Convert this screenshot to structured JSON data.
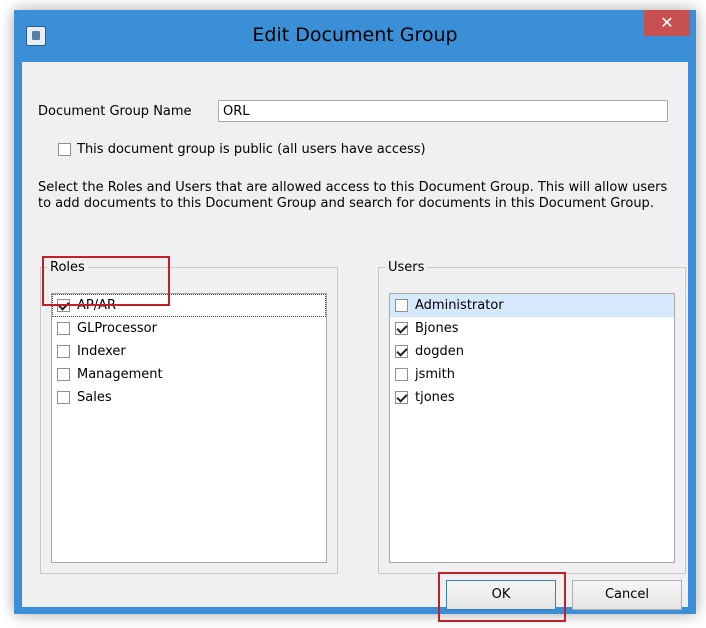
{
  "window": {
    "title": "Edit Document Group",
    "close_glyph": "✕"
  },
  "form": {
    "name_label": "Document Group Name",
    "name_value": "ORL",
    "public_label": "This document group is public (all users have access)",
    "public_checked": false,
    "instructions": "Select the Roles and Users that are allowed access to this Document Group.  This will allow users to add documents to this Document Group and search for documents in this Document Group."
  },
  "roles": {
    "legend": "Roles",
    "items": [
      {
        "label": "AP/AR",
        "checked": true
      },
      {
        "label": "GLProcessor",
        "checked": false
      },
      {
        "label": "Indexer",
        "checked": false
      },
      {
        "label": "Management",
        "checked": false
      },
      {
        "label": "Sales",
        "checked": false
      }
    ]
  },
  "users": {
    "legend": "Users",
    "items": [
      {
        "label": "Administrator",
        "checked": false
      },
      {
        "label": "Bjones",
        "checked": true
      },
      {
        "label": "dogden",
        "checked": true
      },
      {
        "label": "jsmith",
        "checked": false
      },
      {
        "label": "tjones",
        "checked": true
      }
    ]
  },
  "buttons": {
    "ok": "OK",
    "cancel": "Cancel"
  },
  "colors": {
    "title_bar": "#3b8fd6",
    "close_button": "#c75050",
    "highlight": "#c0202a"
  }
}
